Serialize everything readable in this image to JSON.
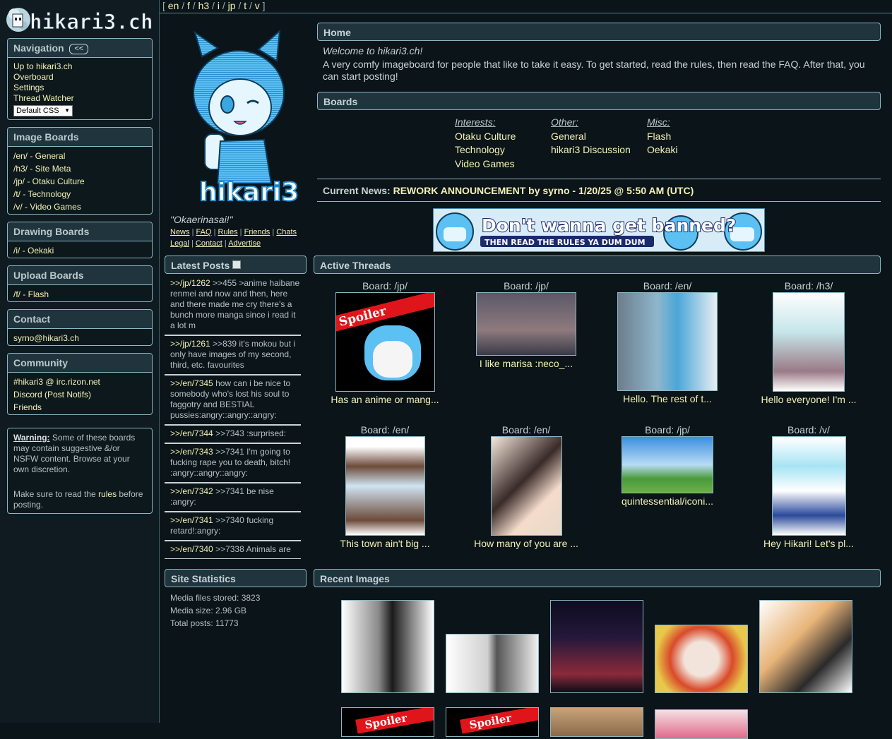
{
  "topnav": {
    "items": [
      "en",
      "f",
      "h3",
      "i",
      "jp",
      "t",
      "v"
    ]
  },
  "logo_text": "hikari3.ch",
  "sidebar": {
    "navigation": {
      "title": "Navigation",
      "toggle": "<<",
      "links": [
        "Up to hikari3.ch",
        "Overboard",
        "Settings",
        "Thread Watcher"
      ],
      "css_select": "Default CSS"
    },
    "image_boards": {
      "title": "Image Boards",
      "links": [
        "/en/ - General",
        "/h3/ - Site Meta",
        "/jp/ - Otaku Culture",
        "/t/ - Technology",
        "/v/ - Video Games"
      ]
    },
    "drawing_boards": {
      "title": "Drawing Boards",
      "links": [
        "/i/ - Oekaki"
      ]
    },
    "upload_boards": {
      "title": "Upload Boards",
      "links": [
        "/f/ - Flash"
      ]
    },
    "contact": {
      "title": "Contact",
      "links": [
        "syrno@hikari3.ch"
      ]
    },
    "community": {
      "title": "Community",
      "links": [
        "#hikari3 @ irc.rizon.net",
        "Discord (Post Notifs)",
        "Friends"
      ]
    },
    "warning": {
      "label": "Warning:",
      "text": " Some of these boards may contain suggestive &/or NSFW content. Browse at your own discretion.",
      "rules_pre": "Make sure to read the ",
      "rules_link": "rules",
      "rules_post": " before posting."
    }
  },
  "mascot": {
    "logo_word": "hikari3",
    "quote": "\"Okaerinasai!\"",
    "links": [
      "News",
      "FAQ",
      "Rules",
      "Friends",
      "Chats",
      "Legal",
      "Contact",
      "Advertise"
    ]
  },
  "home": {
    "title": "Home",
    "welcome": "Welcome to hikari3.ch!",
    "intro": "A very comfy imageboard for people that like to take it easy. To get started, read the rules, then read the FAQ. After that, you can start posting!"
  },
  "boards": {
    "title": "Boards",
    "columns": [
      {
        "heading": "Interests:",
        "items": [
          "Otaku Culture",
          "Technology",
          "Video Games"
        ]
      },
      {
        "heading": "Other:",
        "items": [
          "General",
          "hikari3 Discussion"
        ]
      },
      {
        "heading": "Misc:",
        "items": [
          "Flash",
          "Oekaki"
        ]
      }
    ]
  },
  "news": {
    "label": "Current News:",
    "headline": "REWORK ANNOUNCEMENT by syrno - 1/20/25 @ 5:50 AM (UTC)"
  },
  "banner": {
    "line1": "Don't wanna get banned?",
    "line2": "THEN READ THE RULES YA DUM DUM"
  },
  "latest_posts": {
    "title": "Latest Posts",
    "posts": [
      {
        "ref": ">>/jp/1262",
        "text": " >>455 >anime haibane renmei and now and then, here and there made me cry there's a bunch more manga since i read it a lot m"
      },
      {
        "ref": ">>/jp/1261",
        "text": " >>839 it's mokou but i only have images of my second, third, etc. favourites"
      },
      {
        "ref": ">>/en/7345",
        "text": " how can i be nice to somebody who's lost his soul to faggotry and BESTIAL pussies:angry::angry::angry:"
      },
      {
        "ref": ">>/en/7344",
        "text": " >>7343 :surprised:"
      },
      {
        "ref": ">>/en/7343",
        "text": " >>7341 I'm going to fucking rape you to death, bitch! :angry::angry::angry:"
      },
      {
        "ref": ">>/en/7342",
        "text": " >>7341 be nise :angry:"
      },
      {
        "ref": ">>/en/7341",
        "text": " >>7340 fucking retard!:angry:"
      },
      {
        "ref": ">>/en/7340",
        "text": " >>7338 Animals are"
      }
    ]
  },
  "active_threads": {
    "title": "Active Threads",
    "threads": [
      {
        "board": "Board: /jp/",
        "caption": "Has an anime or mang...",
        "spoiler": "Spoiler"
      },
      {
        "board": "Board: /jp/",
        "caption": "I like marisa :neco_..."
      },
      {
        "board": "Board: /en/",
        "caption": "Hello. The rest of t..."
      },
      {
        "board": "Board: /h3/",
        "caption": "Hello everyone! I'm ..."
      },
      {
        "board": "Board: /en/",
        "caption": "This town ain't big ..."
      },
      {
        "board": "Board: /en/",
        "caption": "How many of you are ..."
      },
      {
        "board": "Board: /jp/",
        "caption": "quintessential/iconi..."
      },
      {
        "board": "Board: /v/",
        "caption": "Hey Hikari! Let's pl..."
      }
    ]
  },
  "site_statistics": {
    "title": "Site Statistics",
    "lines": [
      "Media files stored: 3823",
      "Media size: 2.96 GB",
      "Total posts: 11773"
    ]
  },
  "recent_images": {
    "title": "Recent Images",
    "spoiler": "Spoiler"
  },
  "colors": {
    "background": "#0b1418",
    "panel": "#1f343c",
    "border": "#8ab7c3",
    "link": "#f2f2b6",
    "accent": "#3aa7e0"
  }
}
